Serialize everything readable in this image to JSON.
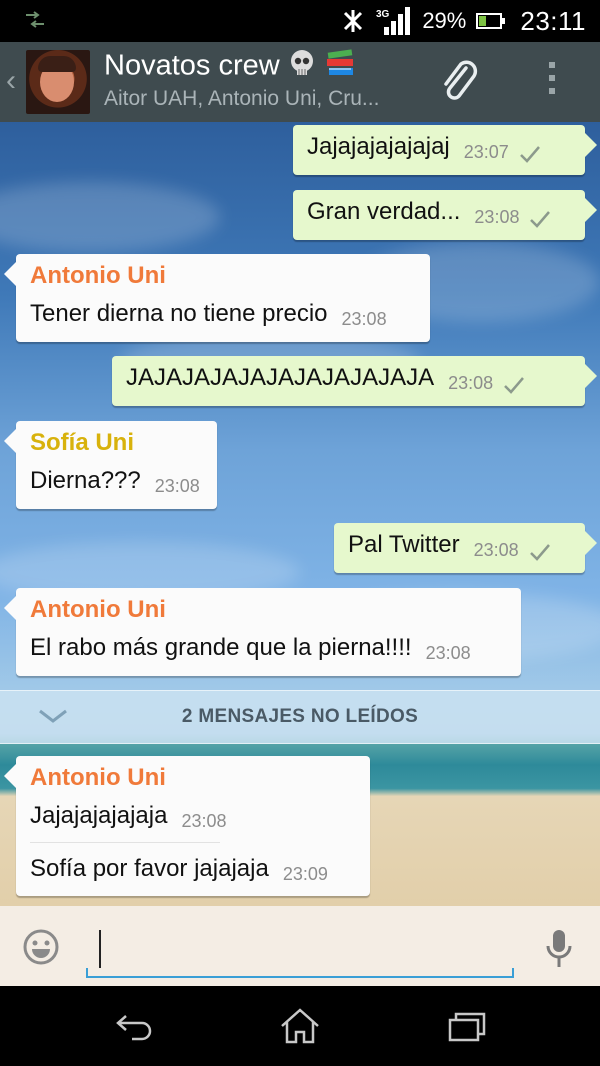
{
  "status_bar": {
    "network": "3G",
    "battery_percent": "29%",
    "time": "23:11",
    "icons": [
      "usb-debug-icon",
      "nfc-disabled-icon",
      "signal-icon",
      "battery-icon"
    ]
  },
  "header": {
    "title": "Novatos crew",
    "title_emoji": [
      "skull-icon",
      "books-icon"
    ],
    "subtitle": "Aitor UAH, Antonio Uni, Cru..."
  },
  "colors": {
    "header_bg": "#3f4b4f",
    "out_bubble": "#e6f8cd",
    "in_bubble": "#fbfbfb",
    "antonio": "#f07a3a",
    "sofia": "#d8b20c",
    "input_accent": "#3a9fd6"
  },
  "messages": [
    {
      "dir": "out",
      "lines": [
        {
          "text": "Jajajajajajajaj",
          "time": "23:07"
        }
      ]
    },
    {
      "dir": "out",
      "lines": [
        {
          "text": "Gran verdad...",
          "time": "23:08"
        }
      ]
    },
    {
      "dir": "in",
      "sender": "Antonio Uni",
      "lines": [
        {
          "text": "Tener dierna no tiene precio",
          "time": "23:08"
        }
      ]
    },
    {
      "dir": "out",
      "lines": [
        {
          "text": "JAJAJAJAJAJAJAJAJAJAJA",
          "time": "23:08"
        }
      ]
    },
    {
      "dir": "in",
      "sender": "Sofía Uni",
      "lines": [
        {
          "text": "Dierna???",
          "time": "23:08"
        }
      ]
    },
    {
      "dir": "out",
      "lines": [
        {
          "text": "Pal Twitter",
          "time": "23:08"
        }
      ]
    },
    {
      "dir": "in",
      "sender": "Antonio Uni",
      "lines": [
        {
          "text": "El rabo más grande que la pierna!!!!",
          "time": "23:08"
        }
      ]
    },
    {
      "dir": "in",
      "sender": "Antonio Uni",
      "lines": [
        {
          "text": "Jajajajajajaja",
          "time": "23:08"
        },
        {
          "text": "Sofía por favor jajajaja",
          "time": "23:09"
        }
      ]
    }
  ],
  "unread_banner": "2 MENSAJES NO LEÍDOS",
  "input": {
    "value": "",
    "placeholder": ""
  },
  "nav": [
    "back-icon",
    "home-icon",
    "recent-apps-icon"
  ]
}
